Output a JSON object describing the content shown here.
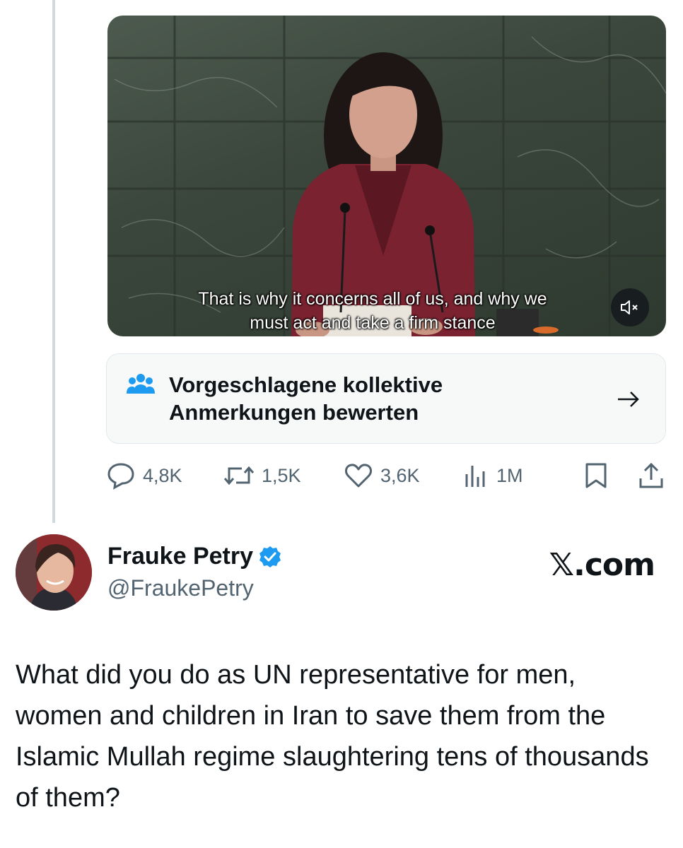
{
  "video": {
    "subtitle_line1": "That is why it concerns all of us, and why we",
    "subtitle_line2": "must act and take a firm stance",
    "mute_icon": "speaker-muted-icon"
  },
  "community_notes": {
    "icon": "people-group-icon",
    "line1": "Vorgeschlagene kollektive",
    "line2": "Anmerkungen bewerten",
    "arrow_icon": "arrow-right-icon"
  },
  "actions": {
    "replies": "4,8K",
    "reposts": "1,5K",
    "likes": "3,6K",
    "views": "1M",
    "bookmark_icon": "bookmark-icon",
    "share_icon": "share-icon"
  },
  "author": {
    "name": "Frauke Petry",
    "handle": "@FraukePetry",
    "verified": true
  },
  "brand": "𝕏.com",
  "tweet": {
    "text": "What did you do as UN representative for men, women and children in Iran to save them from the Islamic Mullah regime slaughtering tens of thousands of them?"
  },
  "colors": {
    "accent": "#1d9bf0",
    "secondary_text": "#536471",
    "border": "#e1e8ed"
  }
}
